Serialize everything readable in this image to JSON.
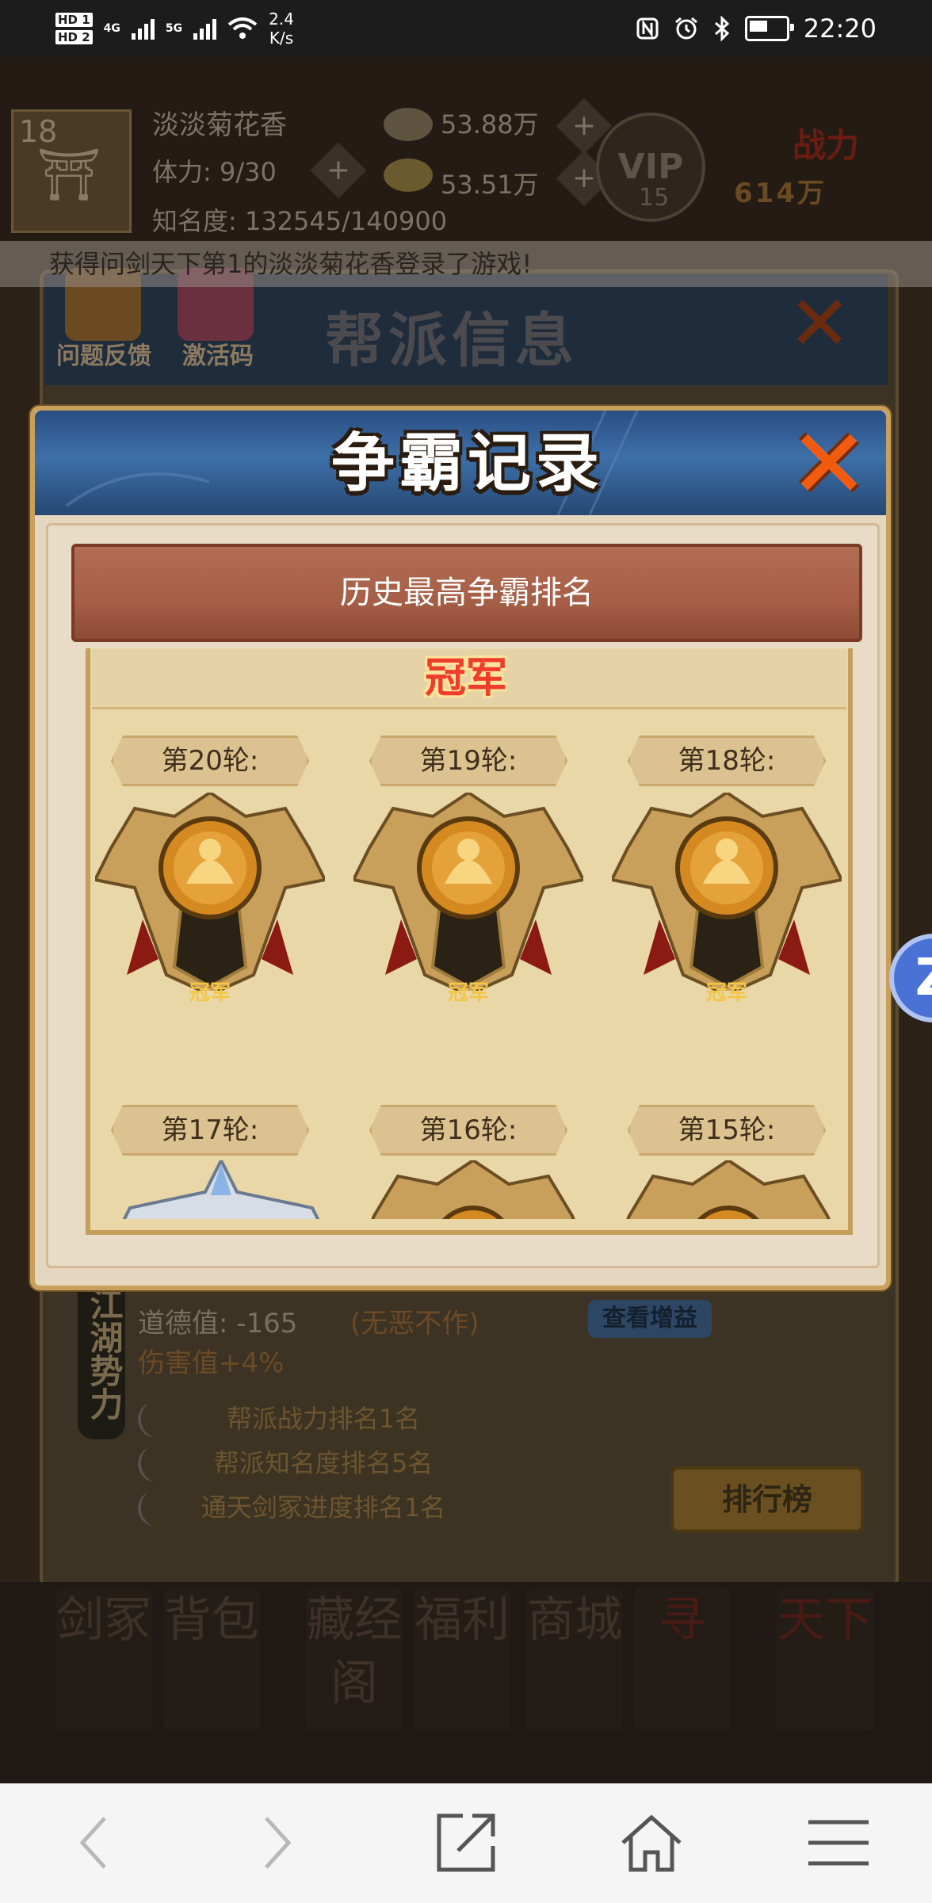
{
  "status_bar": {
    "sim1": "HD 1",
    "sim2": "HD 2",
    "net1": "4G",
    "net2": "5G",
    "speed_value": "2.4",
    "speed_unit": "K/s",
    "time": "22:20"
  },
  "player": {
    "level": "18",
    "name": "淡淡菊花香",
    "stamina": "体力: 9/30",
    "fame": "知名度: 132545/140900",
    "currency1": "53.88万",
    "currency2": "53.51万",
    "vip": "VIP",
    "vip_level": "15",
    "power_label": "战力",
    "power_value": "614万"
  },
  "broadcast": "获得问剑天下第1的淡淡菊花香登录了游戏!",
  "background_ui": {
    "feedback_label": "问题反馈",
    "activation_label": "激活码",
    "guild_title": "帮派信息",
    "morality": "道德值: -165",
    "morality_note": "(无恶不作)",
    "view_bonus": "查看增益",
    "damage": "伤害值+4%",
    "faction_label": "江湖势力",
    "ranks": [
      "帮派战力排名1名",
      "帮派知名度排名5名",
      "通天剑冢进度排名1名"
    ],
    "leaderboard": "排行榜",
    "menu": [
      "剑冢",
      "背包",
      "藏经阁",
      "福利",
      "商城",
      "寻",
      "天下"
    ]
  },
  "modal": {
    "title": "争霸记录",
    "subtitle": "历史最高争霸排名",
    "section_title": "冠军",
    "rounds": [
      {
        "label": "第20轮:",
        "medal": "gold",
        "medal_text": "冠军"
      },
      {
        "label": "第19轮:",
        "medal": "gold",
        "medal_text": "冠军"
      },
      {
        "label": "第18轮:",
        "medal": "gold",
        "medal_text": "冠军"
      },
      {
        "label": "第17轮:",
        "medal": "silver",
        "medal_text": ""
      },
      {
        "label": "第16轮:",
        "medal": "gold",
        "medal_text": ""
      },
      {
        "label": "第15轮:",
        "medal": "gold",
        "medal_text": ""
      }
    ]
  },
  "float_button": "Z",
  "colors": {
    "modal_header": "#3d6fa8",
    "ribbon": "#a65e46",
    "champion_text": "#ee3d2b",
    "close_x": "#f25a10"
  }
}
